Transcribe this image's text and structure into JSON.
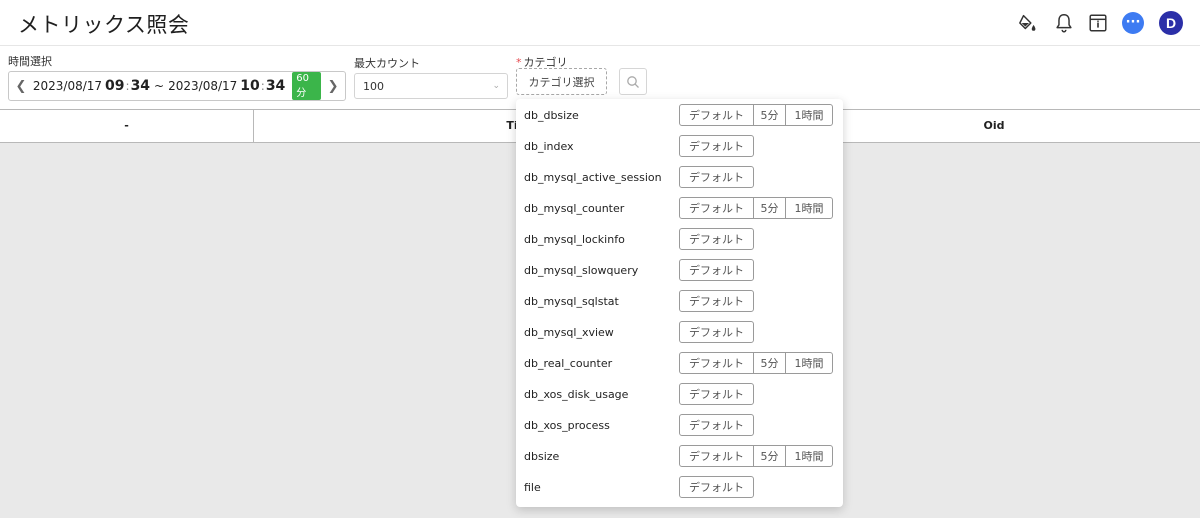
{
  "header": {
    "title": "メトリックス照会",
    "avatar_letter": "D",
    "chat_glyph": "···"
  },
  "filters": {
    "time_label": "時間選択",
    "time_from_date": "2023/08/17",
    "time_from_hour": "09",
    "time_from_min": "34",
    "time_sep": "~",
    "time_to_date": "2023/08/17",
    "time_to_hour": "10",
    "time_to_min": "34",
    "duration_badge": "60分",
    "max_count_label": "最大カウント",
    "max_count_value": "100",
    "category_label": "カテゴリ",
    "category_button": "カテゴリ選択"
  },
  "table": {
    "columns": [
      "-",
      "Ti",
      "Oid"
    ]
  },
  "dropdown": {
    "items": [
      {
        "name": "db_dbsize",
        "tags": [
          "デフォルト",
          "5分",
          "1時間"
        ]
      },
      {
        "name": "db_index",
        "tags": [
          "デフォルト"
        ]
      },
      {
        "name": "db_mysql_active_session",
        "tags": [
          "デフォルト"
        ]
      },
      {
        "name": "db_mysql_counter",
        "tags": [
          "デフォルト",
          "5分",
          "1時間"
        ]
      },
      {
        "name": "db_mysql_lockinfo",
        "tags": [
          "デフォルト"
        ]
      },
      {
        "name": "db_mysql_slowquery",
        "tags": [
          "デフォルト"
        ]
      },
      {
        "name": "db_mysql_sqlstat",
        "tags": [
          "デフォルト"
        ]
      },
      {
        "name": "db_mysql_xview",
        "tags": [
          "デフォルト"
        ]
      },
      {
        "name": "db_real_counter",
        "tags": [
          "デフォルト",
          "5分",
          "1時間"
        ]
      },
      {
        "name": "db_xos_disk_usage",
        "tags": [
          "デフォルト"
        ]
      },
      {
        "name": "db_xos_process",
        "tags": [
          "デフォルト"
        ]
      },
      {
        "name": "dbsize",
        "tags": [
          "デフォルト",
          "5分",
          "1時間"
        ]
      },
      {
        "name": "file",
        "tags": [
          "デフォルト"
        ]
      }
    ]
  },
  "colors": {
    "accent_blue": "#3d7bf2",
    "avatar_bg": "#2b2fa8",
    "badge_green": "#3bb54a",
    "required_red": "#e5484d"
  },
  "icons": [
    "paint-bucket-icon",
    "bell-icon",
    "window-info-icon",
    "chat-icon",
    "chevron-left-icon",
    "chevron-right-icon",
    "chevron-down-icon",
    "search-icon"
  ]
}
